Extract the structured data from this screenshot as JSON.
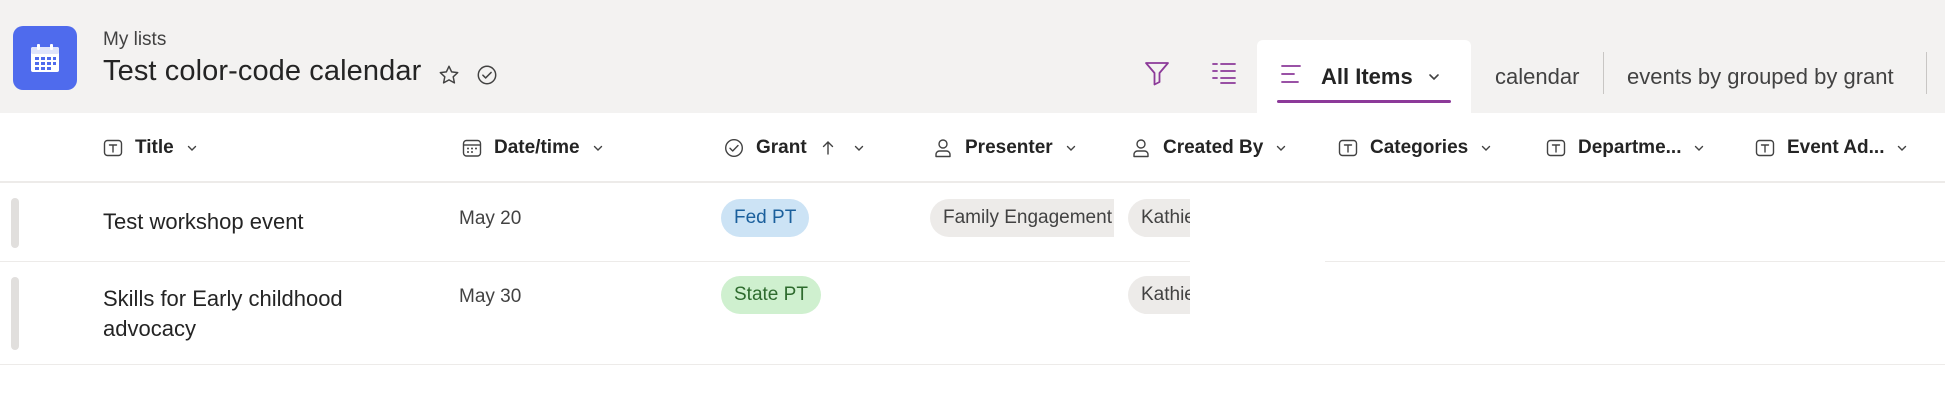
{
  "header": {
    "breadcrumb": "My lists",
    "title": "Test color-code calendar",
    "accent_color": "#4f6bed"
  },
  "views": {
    "active": "All Items",
    "others": [
      "calendar",
      "events by grouped by grant"
    ],
    "underline_color": "#8c3a99"
  },
  "columns": [
    {
      "label": "Title",
      "icon": "text-field-icon"
    },
    {
      "label": "Date/time",
      "icon": "calendar-field-icon"
    },
    {
      "label": "Grant",
      "icon": "choice-field-icon",
      "sorted": "ascending"
    },
    {
      "label": "Presenter",
      "icon": "person-field-icon"
    },
    {
      "label": "Created By",
      "icon": "person-field-icon"
    },
    {
      "label": "Categories",
      "icon": "text-field-icon"
    },
    {
      "label": "Departme...",
      "icon": "text-field-icon"
    },
    {
      "label": "Event Ad...",
      "icon": "text-field-icon"
    }
  ],
  "rows": [
    {
      "title": "Test workshop event",
      "date": "May 20",
      "grant": {
        "label": "Fed PT",
        "color": "#cce3f5"
      },
      "presenter": "Family Engagement",
      "created_by": "Kathie"
    },
    {
      "title": "Skills for Early childhood advocacy",
      "date": "May 30",
      "grant": {
        "label": "State PT",
        "color": "#cff0cf"
      },
      "presenter": "",
      "created_by": "Kathie"
    }
  ]
}
